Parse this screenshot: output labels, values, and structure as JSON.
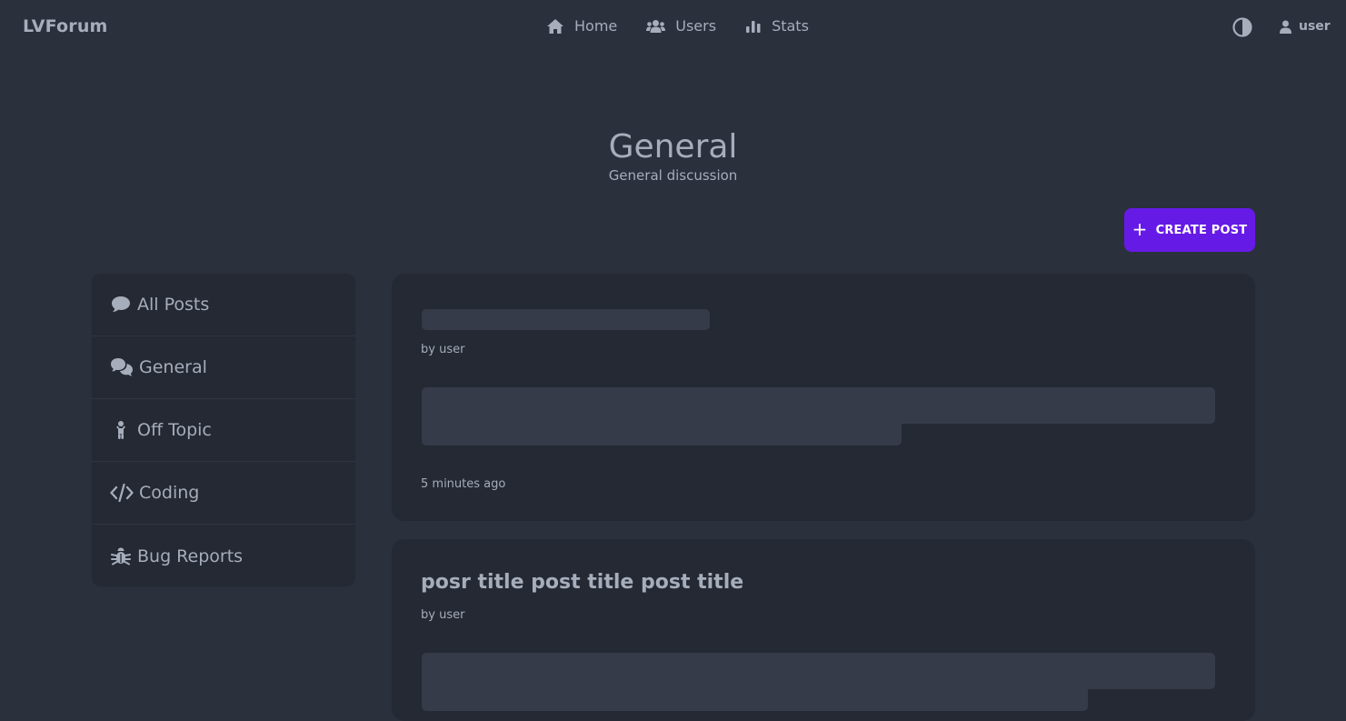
{
  "nav": {
    "brand": "LVForum",
    "items": [
      {
        "label": "Home",
        "icon": "home-icon"
      },
      {
        "label": "Users",
        "icon": "users-icon"
      },
      {
        "label": "Stats",
        "icon": "stats-icon"
      }
    ],
    "theme_icon": "contrast-icon",
    "user_label": "user"
  },
  "hero": {
    "title": "General",
    "subtitle": "General discussion"
  },
  "actions": {
    "create_post_label": "CREATE POST"
  },
  "sidebar": {
    "items": [
      {
        "label": "All Posts",
        "icon": "comment-icon"
      },
      {
        "label": "General",
        "icon": "comments-icon"
      },
      {
        "label": "Off Topic",
        "icon": "child-icon"
      },
      {
        "label": "Coding",
        "icon": "code-icon"
      },
      {
        "label": "Bug Reports",
        "icon": "bug-icon"
      }
    ]
  },
  "posts": [
    {
      "title": "",
      "author": "by user",
      "time": "5 minutes ago"
    },
    {
      "title": "posr title post title post title",
      "author": "by user",
      "time": ""
    }
  ],
  "colors": {
    "background": "#2a303c",
    "card": "#242933",
    "accent": "#661ae6",
    "text": "#a6adbb",
    "skeleton": "#353b49"
  }
}
